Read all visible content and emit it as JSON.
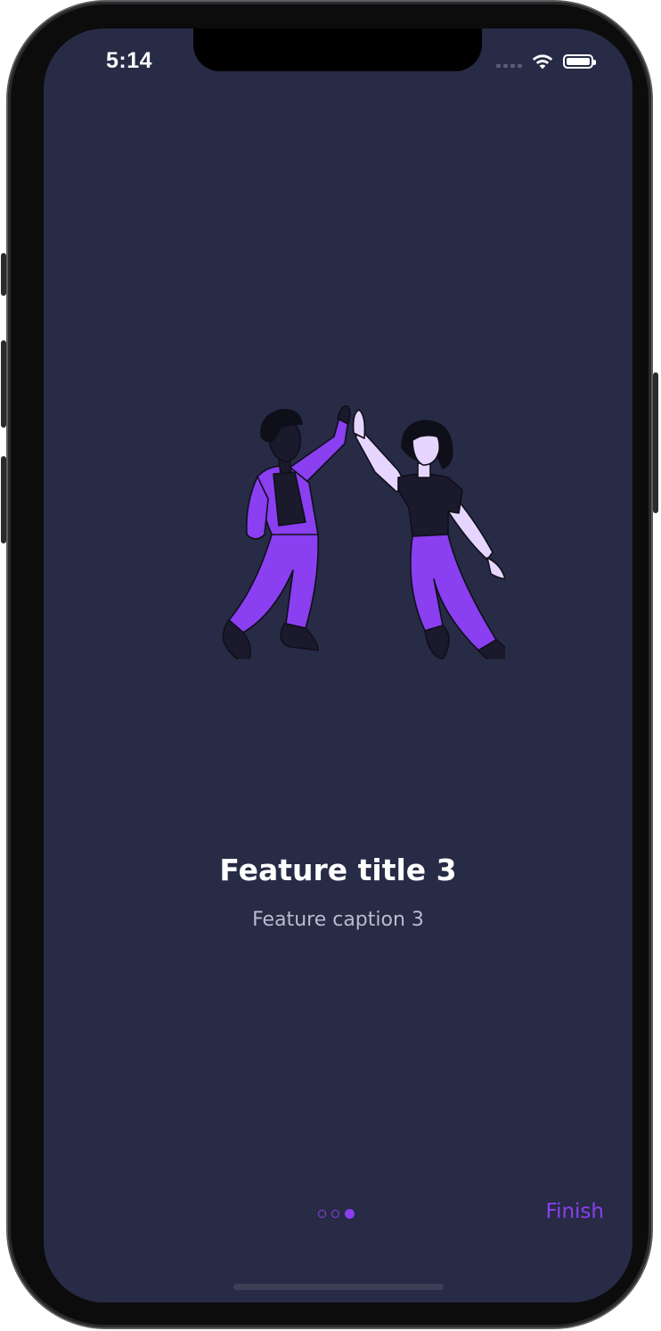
{
  "status_bar": {
    "time": "5:14",
    "icons": [
      "cellular-signal-icon",
      "wifi-icon",
      "battery-icon"
    ]
  },
  "onboarding": {
    "illustration": "two-people-high-five-illustration",
    "title": "Feature title 3",
    "caption": "Feature caption 3",
    "page_indicator": {
      "total_pages": 3,
      "current_page": 3
    },
    "finish_label": "Finish"
  },
  "colors": {
    "background": "#272b46",
    "accent": "#8a3ff0",
    "title_text": "#ffffff",
    "caption_text": "#b9bccd"
  }
}
